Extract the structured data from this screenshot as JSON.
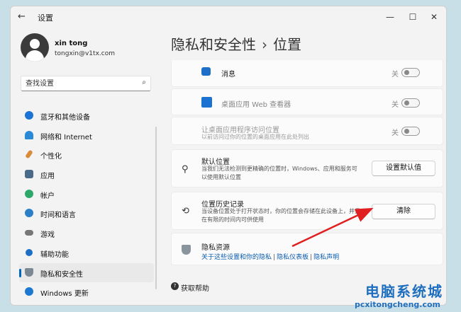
{
  "window": {
    "title": "设置"
  },
  "user": {
    "name": "xin tong",
    "email": "tongxin@v1tx.com"
  },
  "search": {
    "placeholder": "查找设置"
  },
  "nav": [
    {
      "label": "蓝牙和其他设备",
      "icon": "bluetooth-icon"
    },
    {
      "label": "网络和 Internet",
      "icon": "wifi-icon"
    },
    {
      "label": "个性化",
      "icon": "brush-icon"
    },
    {
      "label": "应用",
      "icon": "apps-icon"
    },
    {
      "label": "帐户",
      "icon": "account-icon"
    },
    {
      "label": "时间和语言",
      "icon": "globe-icon"
    },
    {
      "label": "游戏",
      "icon": "gamepad-icon"
    },
    {
      "label": "辅助功能",
      "icon": "accessibility-icon"
    },
    {
      "label": "隐私和安全性",
      "icon": "shield-icon",
      "active": true
    },
    {
      "label": "Windows 更新",
      "icon": "update-icon"
    }
  ],
  "page": {
    "breadcrumb_parent": "隐私和安全性",
    "separator": "›",
    "title": "位置"
  },
  "settings": {
    "messages": {
      "title": "消息",
      "toggle_label": "关"
    },
    "web_viewer": {
      "title": "桌面应用 Web 查看器",
      "toggle_label": "关"
    },
    "desktop_access": {
      "title": "让桌面应用程序访问位置",
      "subtitle": "以前访问过你的位置的桌面应用在此处列出",
      "toggle_label": "关"
    },
    "default_location": {
      "title": "默认位置",
      "subtitle": "当我们无法检测到更精确的位置时，Windows、应用和服务可以使用默认位置",
      "button": "设置默认值"
    },
    "location_history": {
      "title": "位置历史记录",
      "subtitle": "当设备位置处于打开状态时，你的位置会存储在此设备上，并且在有限的时间内可供使用",
      "button": "清除"
    },
    "privacy": {
      "title": "隐私资源",
      "link1": "关于这些设置和你的隐私",
      "link2": "隐私仪表板",
      "link3": "隐私声明"
    }
  },
  "help": {
    "label": "获取帮助"
  },
  "watermark": {
    "title": "电脑系统城",
    "url": "pcxitongcheng.com"
  },
  "colors": {
    "accent": "#0067c0",
    "arrow": "#e02020"
  }
}
